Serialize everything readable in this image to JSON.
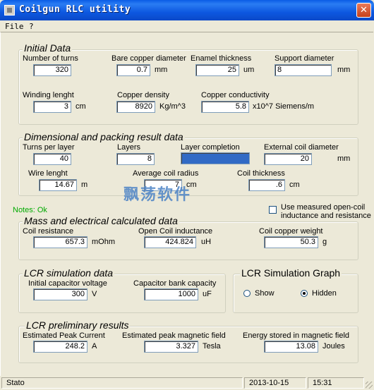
{
  "window": {
    "title": "Coilgun RLC utility",
    "close_label": "✕"
  },
  "menu": {
    "file": "File",
    "help": "?"
  },
  "initial": {
    "title": "Initial Data",
    "turns_label": "Number of turns",
    "turns": "320",
    "bare_label": "Bare copper diameter",
    "bare": "0.7",
    "bare_unit": "mm",
    "enamel_label": "Enamel thickness",
    "enamel": "25",
    "enamel_unit": "um",
    "support_label": "Support diameter",
    "support": "8",
    "support_unit": "mm",
    "winding_label": "Winding lenght",
    "winding": "3",
    "winding_unit": "cm",
    "density_label": "Copper density",
    "density": "8920",
    "density_unit": "Kg/m^3",
    "conductivity_label": "Copper conductivity",
    "conductivity": "5.8",
    "conductivity_unit": "x10^7 Siemens/m"
  },
  "dimensional": {
    "title": "Dimensional and packing result data",
    "tpl_label": "Turns per layer",
    "tpl": "40",
    "layers_label": "Layers",
    "layers": "8",
    "completion_label": "Layer completion",
    "completion": 1.0,
    "extdiam_label": "External coil diameter",
    "extdiam": "20",
    "extdiam_unit": "mm",
    "wire_label": "Wire lenght",
    "wire": "14.67",
    "wire_unit": "m",
    "avgradius_label": "Average coil radius",
    "avgradius": "7",
    "avgradius_unit": "cm",
    "thickness_label": "Coil thickness",
    "thickness": ".6",
    "thickness_unit": "cm"
  },
  "notes": "Notes: Ok",
  "measured": {
    "label_line1": "Use measured open-coil",
    "label_line2": "inductance and resistance",
    "checked": false
  },
  "mass": {
    "title": "Mass and electrical calculated data",
    "resistance_label": "Coil resistance",
    "resistance": "657.3",
    "resistance_unit": "mOhm",
    "inductance_label": "Open Coil inductance",
    "inductance": "424.824",
    "inductance_unit": "uH",
    "weight_label": "Coil copper weight",
    "weight": "50.3",
    "weight_unit": "g"
  },
  "lcr_sim": {
    "title": "LCR simulation data",
    "voltage_label": "Initial capacitor voltage",
    "voltage": "300",
    "voltage_unit": "V",
    "capacity_label": "Capacitor bank capacity",
    "capacity": "1000",
    "capacity_unit": "uF"
  },
  "lcr_graph": {
    "title": "LCR Simulation Graph",
    "show_label": "Show",
    "hidden_label": "Hidden",
    "selected": "Hidden"
  },
  "lcr_results": {
    "title": "LCR preliminary results",
    "current_label": "Estimated Peak Current",
    "current": "248.2",
    "current_unit": "A",
    "field_label": "Estimated peak magnetic field",
    "field": "3.327",
    "field_unit": "Tesla",
    "energy_label": "Energy stored in magnetic field",
    "energy": "13.08",
    "energy_unit": "Joules"
  },
  "watermark": "飘荡软件",
  "status": {
    "text": "Stato",
    "date": "2013-10-15",
    "time": "15:31"
  },
  "colors": {
    "title_bar": "#0a5ce6",
    "progress": "#316ac5",
    "notes": "#00aa00",
    "window_bg": "#ece9d8"
  }
}
